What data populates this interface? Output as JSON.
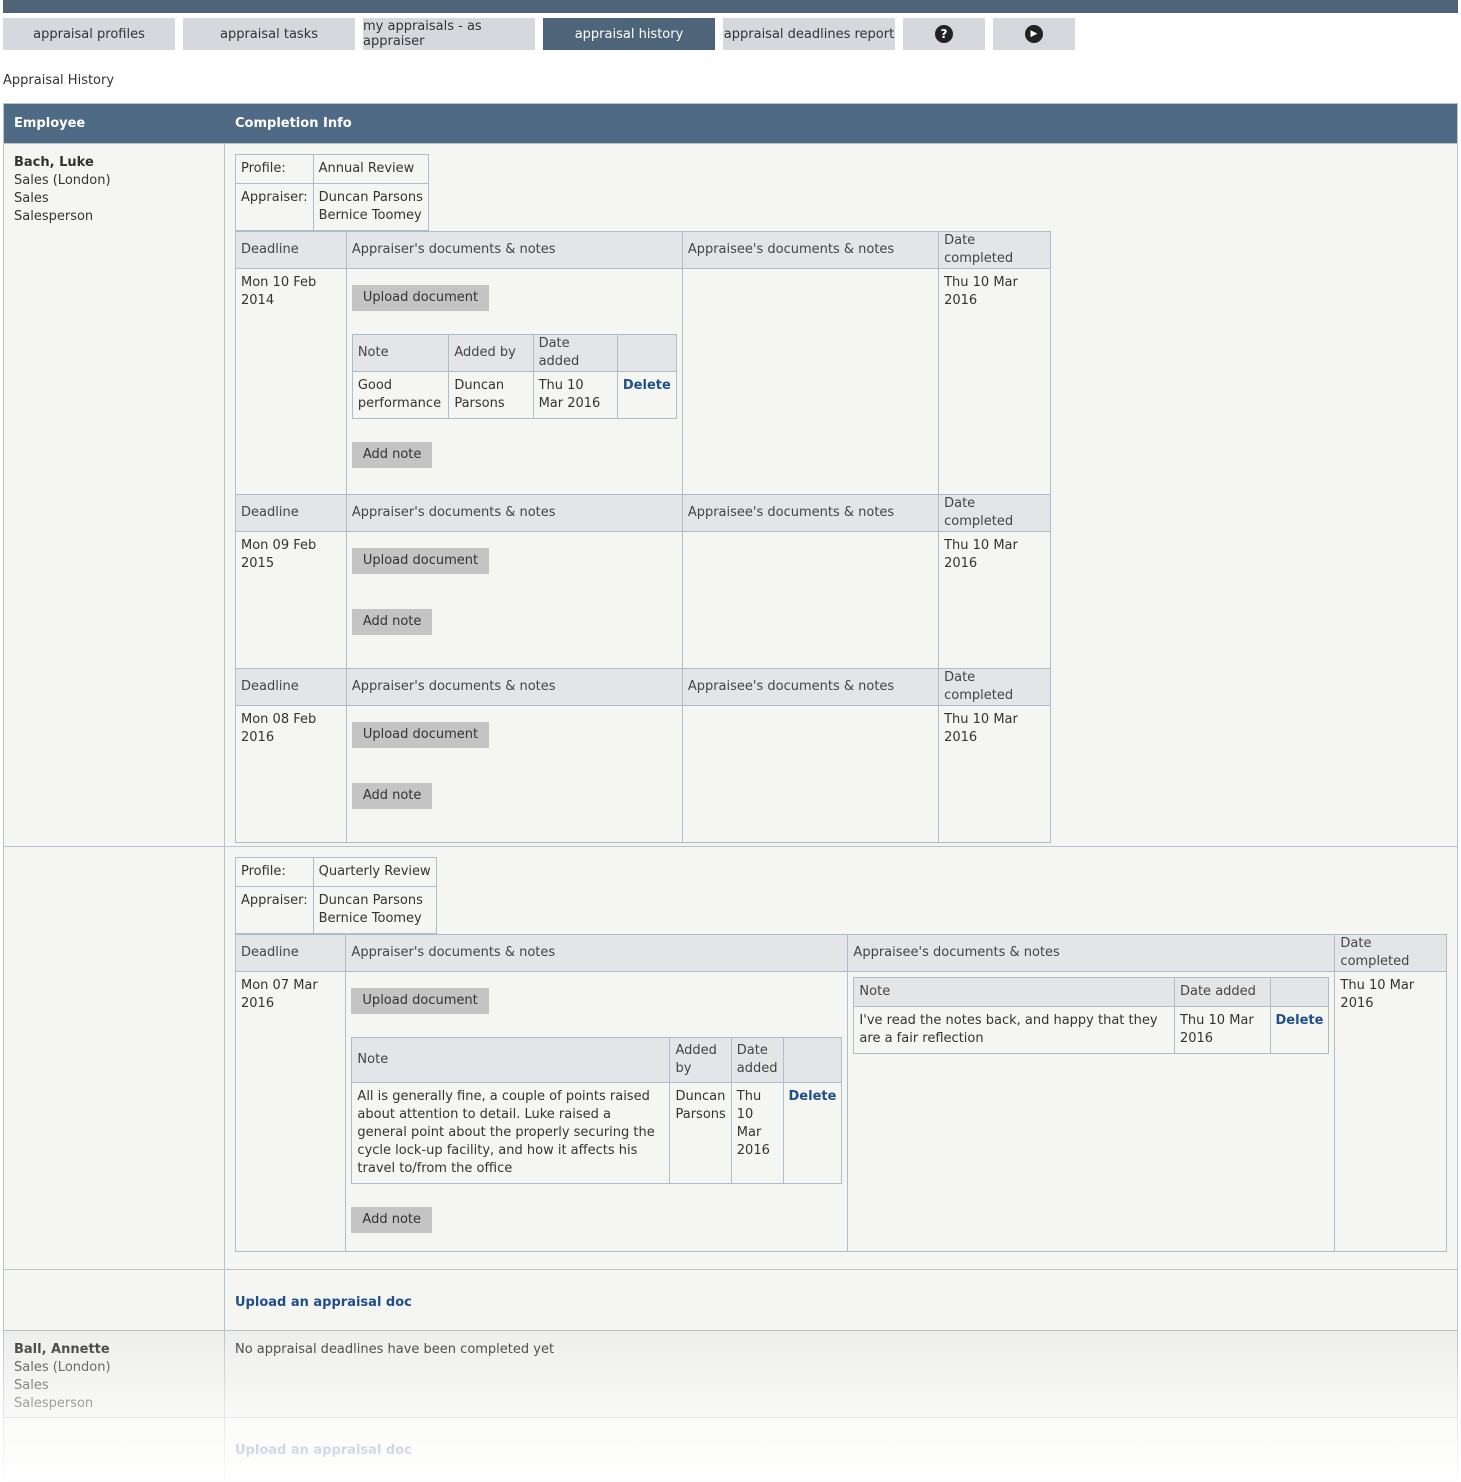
{
  "tabs": [
    {
      "label": "appraisal profiles"
    },
    {
      "label": "appraisal tasks"
    },
    {
      "label": "my appraisals - as appraiser"
    },
    {
      "label": "appraisal history"
    },
    {
      "label": "appraisal deadlines report"
    },
    {
      "icon": "help-icon",
      "glyph": "?"
    },
    {
      "icon": "play-icon",
      "glyph": "▶"
    }
  ],
  "page_title": "Appraisal History",
  "table_headers": {
    "employee": "Employee",
    "completion": "Completion Info"
  },
  "labels": {
    "profile": "Profile:",
    "appraiser": "Appraiser:",
    "deadline": "Deadline",
    "appraiser_docs": "Appraiser's documents & notes",
    "appraisee_docs": "Appraisee's documents & notes",
    "date_completed": "Date completed",
    "upload_document": "Upload document",
    "add_note": "Add note",
    "note": "Note",
    "added_by": "Added by",
    "date_added": "Date added",
    "added_by_wrapped": "Added by",
    "delete": "Delete",
    "upload_appraisal_doc": "Upload an appraisal doc"
  },
  "employees": [
    {
      "name": "Bach, Luke",
      "lines": [
        "Sales (London)",
        "Sales",
        "Salesperson"
      ],
      "profiles": [
        {
          "profile": "Annual Review",
          "appraisers": [
            "Duncan Parsons",
            "Bernice Toomey"
          ],
          "deadlines": [
            {
              "deadline": "Mon 10 Feb 2014",
              "completed": "Thu 10 Mar 2016",
              "notes": [
                {
                  "note": "Good performance",
                  "added_by": "Duncan Parsons",
                  "date_added": "Thu 10 Mar 2016"
                }
              ]
            },
            {
              "deadline": "Mon 09 Feb 2015",
              "completed": "Thu 10 Mar 2016",
              "notes": []
            },
            {
              "deadline": "Mon 08 Feb 2016",
              "completed": "Thu 10 Mar 2016",
              "notes": []
            }
          ]
        },
        {
          "profile": "Quarterly Review",
          "appraisers": [
            "Duncan Parsons",
            "Bernice Toomey"
          ],
          "deadlines": [
            {
              "deadline": "Mon 07 Mar 2016",
              "completed": "Thu 10 Mar 2016",
              "notes": [
                {
                  "note": "All is generally fine, a couple of points raised about attention to detail. Luke raised a general point about the properly securing the cycle lock-up facility, and how it affects his travel to/from the office",
                  "added_by": "Duncan Parsons",
                  "date_added": "Thu 10 Mar 2016"
                }
              ],
              "appraisee_notes": [
                {
                  "note": "I've read the notes back, and happy that they are a fair reflection",
                  "date_added": "Thu 10 Mar 2016"
                }
              ]
            }
          ]
        }
      ]
    },
    {
      "name": "Ball, Annette",
      "lines": [
        "Sales (London)",
        "Sales",
        "Salesperson"
      ],
      "empty_message": "No appraisal deadlines have been completed yet"
    }
  ]
}
